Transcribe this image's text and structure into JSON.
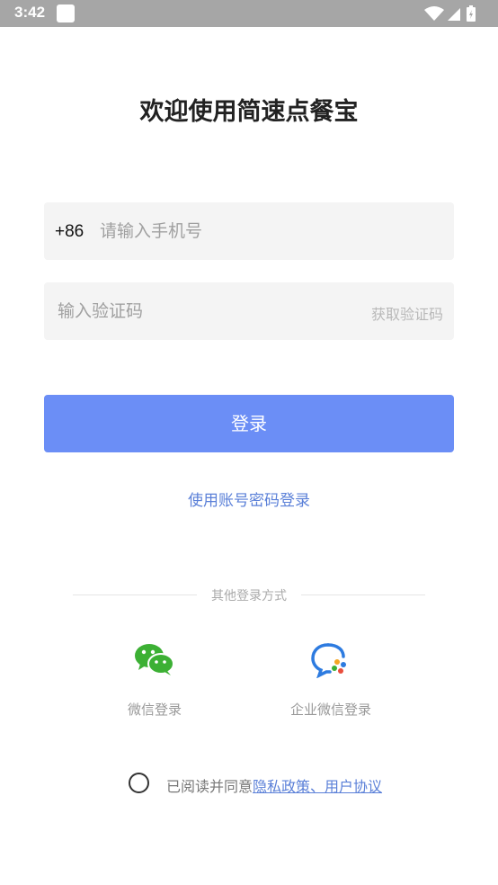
{
  "status_bar": {
    "time": "3:42",
    "icons": [
      "notification-square-icon",
      "wifi-icon",
      "signal-icon",
      "battery-icon"
    ]
  },
  "title": "欢迎使用简速点餐宝",
  "phone": {
    "country_code": "+86",
    "placeholder": "请输入手机号",
    "value": ""
  },
  "code": {
    "placeholder": "输入验证码",
    "value": "",
    "get_code_label": "获取验证码"
  },
  "login_button": "登录",
  "password_login_link": "使用账号密码登录",
  "other_login": {
    "title": "其他登录方式",
    "options": [
      {
        "label": "微信登录",
        "icon": "wechat-icon"
      },
      {
        "label": "企业微信登录",
        "icon": "wework-icon"
      }
    ]
  },
  "agreement": {
    "checked": false,
    "prefix": "已阅读并同意",
    "link": "隐私政策、用户协议"
  },
  "colors": {
    "status_bar": "#a6a6a6",
    "primary_button": "#6b8ef6",
    "link": "#5b80d8",
    "wechat_green": "#3cb034",
    "wework_blue": "#2d7be0"
  }
}
